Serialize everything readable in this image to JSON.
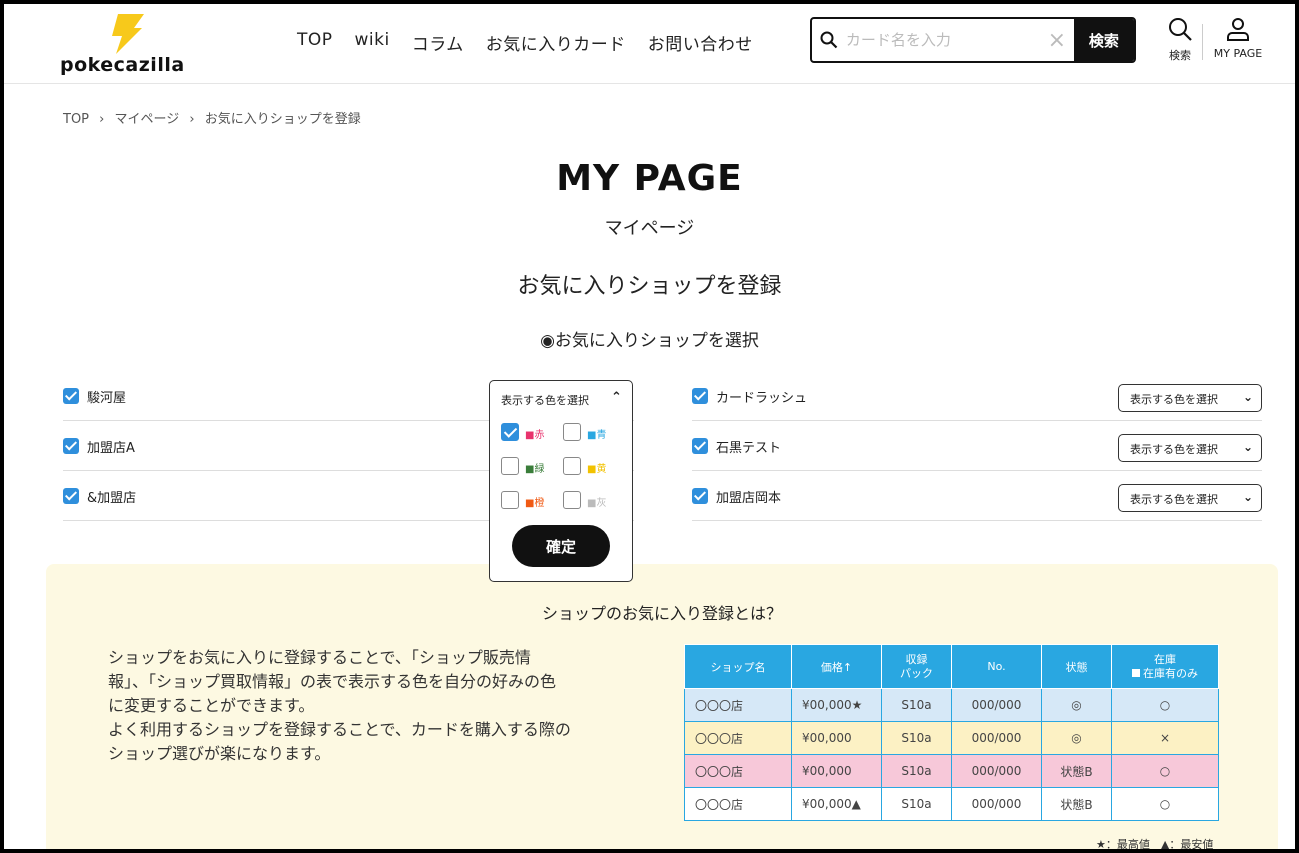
{
  "header": {
    "logo_text": "pokecazilla",
    "nav": [
      "TOP",
      "wiki",
      "コラム",
      "お気に入りカード",
      "お問い合わせ"
    ],
    "search_placeholder": "カード名を入力",
    "search_button": "検索",
    "search_icon_label": "検索",
    "mypage_icon_label": "MY PAGE"
  },
  "breadcrumb": [
    "TOP",
    "›",
    "マイページ",
    "›",
    "お気に入りショップを登録"
  ],
  "page": {
    "title": "MY PAGE",
    "subtitle": "マイページ",
    "section_title": "お気に入りショップを登録",
    "select_heading": "◉お気に入りショップを選択"
  },
  "shops_left": [
    {
      "name": "駿河屋"
    },
    {
      "name": "加盟店A"
    },
    {
      "name": "&加盟店"
    }
  ],
  "shops_right": [
    {
      "name": "カードラッシュ",
      "select": "表示する色を選択"
    },
    {
      "name": "石黒テスト",
      "select": "表示する色を選択"
    },
    {
      "name": "加盟店岡本",
      "select": "表示する色を選択"
    }
  ],
  "color_popup": {
    "header": "表示する色を選択",
    "options": [
      {
        "label": "■赤",
        "color": "#e8336d",
        "checked": true
      },
      {
        "label": "■青",
        "color": "#29a7e1",
        "checked": false
      },
      {
        "label": "■緑",
        "color": "#3a7d3a",
        "checked": false
      },
      {
        "label": "■黄",
        "color": "#f2c200",
        "checked": false
      },
      {
        "label": "■橙",
        "color": "#f05a14",
        "checked": false
      },
      {
        "label": "■灰",
        "color": "#bbbbbb",
        "checked": false
      }
    ],
    "confirm": "確定"
  },
  "info": {
    "title": "ショップのお気に入り登録とは？",
    "text_lines": [
      "ショップをお気に入りに登録することで、「ショップ販売情",
      "報」、「ショップ買取情報」の表で表示する色を自分の好みの色",
      "に変更することができます。",
      "よく利用するショップを登録することで、カードを購入する際の",
      "ショップ選びが楽になります。"
    ],
    "table": {
      "headers": [
        "ショップ名",
        "価格↑",
        "収録\nパック",
        "No.",
        "状態",
        "在庫"
      ],
      "stock_filter": "在庫有のみ",
      "rows": [
        {
          "cells": [
            "〇〇〇店",
            "¥00,000★",
            "S10a",
            "000/000",
            "◎",
            "○"
          ],
          "bg": "#d6e8f7"
        },
        {
          "cells": [
            "〇〇〇店",
            "¥00,000",
            "S10a",
            "000/000",
            "◎",
            "×"
          ],
          "bg": "#fcf1c4"
        },
        {
          "cells": [
            "〇〇〇店",
            "¥00,000",
            "S10a",
            "000/000",
            "状態B",
            "○"
          ],
          "bg": "#f7c8d9"
        },
        {
          "cells": [
            "〇〇〇店",
            "¥00,000▲",
            "S10a",
            "000/000",
            "状態B",
            "○"
          ],
          "bg": "#ffffff"
        }
      ]
    },
    "legend": "★：最高値　▲：最安値"
  }
}
